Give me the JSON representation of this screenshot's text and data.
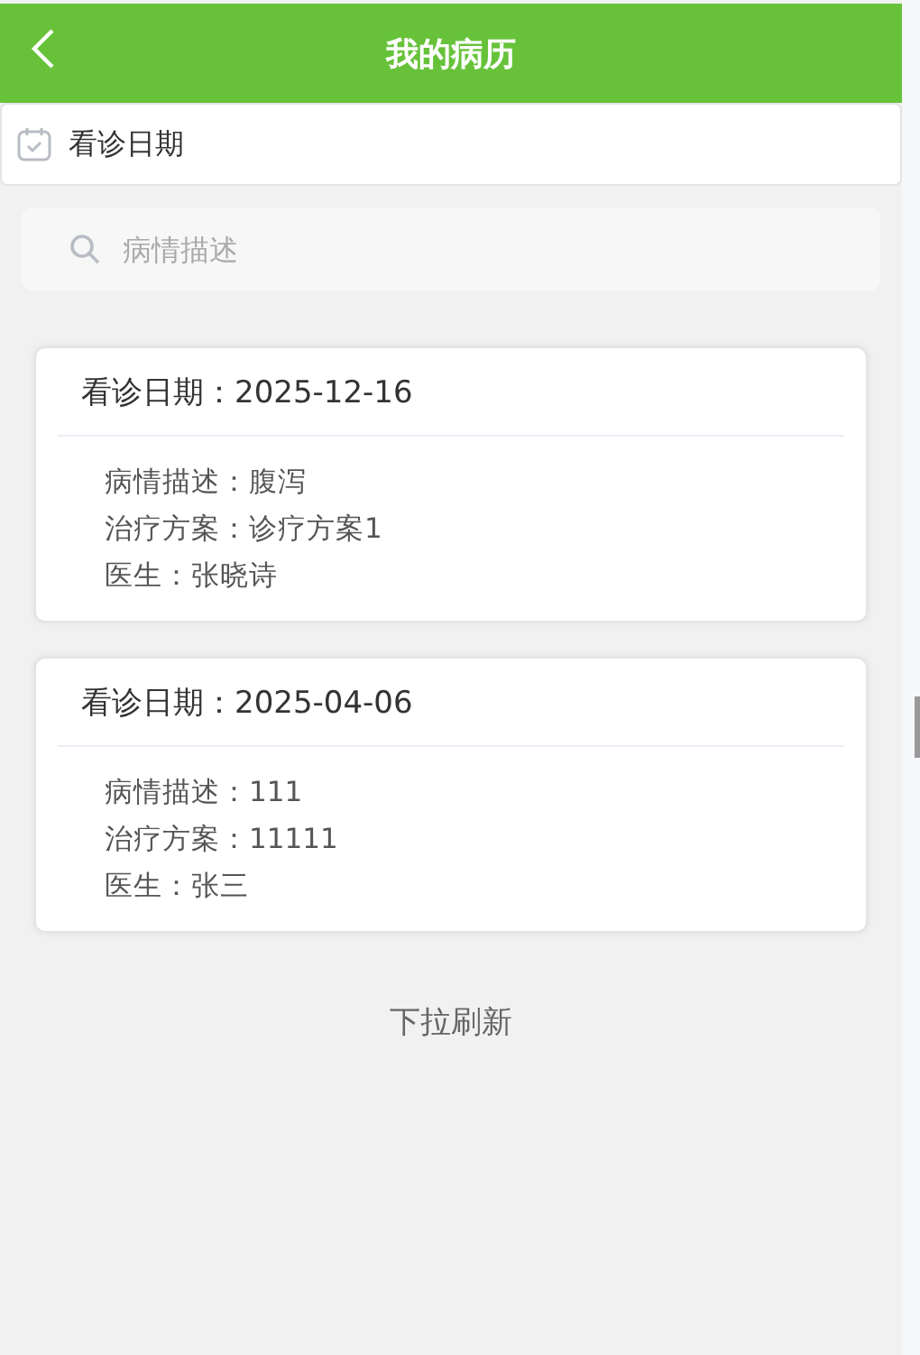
{
  "header": {
    "title": "我的病历"
  },
  "date_filter": {
    "label": "看诊日期"
  },
  "search": {
    "placeholder": "病情描述"
  },
  "records": [
    {
      "title": "看诊日期：2025-12-16",
      "lines": [
        "病情描述：腹泻",
        "治疗方案：诊疗方案1",
        "医生：张晓诗"
      ]
    },
    {
      "title": "看诊日期：2025-04-06",
      "lines": [
        "病情描述：111",
        "治疗方案：11111",
        "医生：张三"
      ]
    }
  ],
  "footer_hint": "下拉刷新"
}
